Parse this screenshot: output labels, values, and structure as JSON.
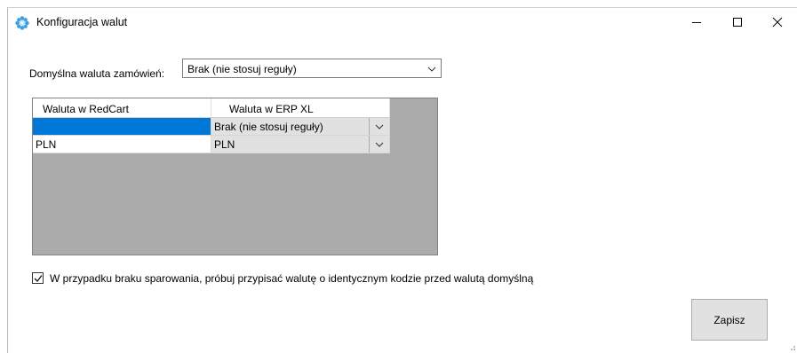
{
  "window": {
    "title": "Konfiguracja walut",
    "icon": "gear-flower-icon",
    "controls": {
      "minimize": "minimize-icon",
      "maximize": "maximize-icon",
      "close": "close-icon"
    }
  },
  "default_currency": {
    "label": "Domyślna waluta zamówień:",
    "selected": "Brak (nie stosuj reguły)"
  },
  "grid": {
    "columns": [
      "Waluta w RedCart",
      "Waluta w ERP XL"
    ],
    "rows": [
      {
        "redcart": "",
        "erp": "Brak (nie stosuj reguły)",
        "selected": true
      },
      {
        "redcart": "PLN",
        "erp": "PLN",
        "selected": false
      }
    ]
  },
  "checkbox": {
    "checked": true,
    "label": "W przypadku braku sparowania, próbuj przypisać walutę o identycznym kodzie przed walutą domyślną"
  },
  "actions": {
    "save_label": "Zapisz"
  },
  "colors": {
    "selection": "#0078d7",
    "grid_background": "#ababab",
    "button_face": "#e1e1e1"
  }
}
